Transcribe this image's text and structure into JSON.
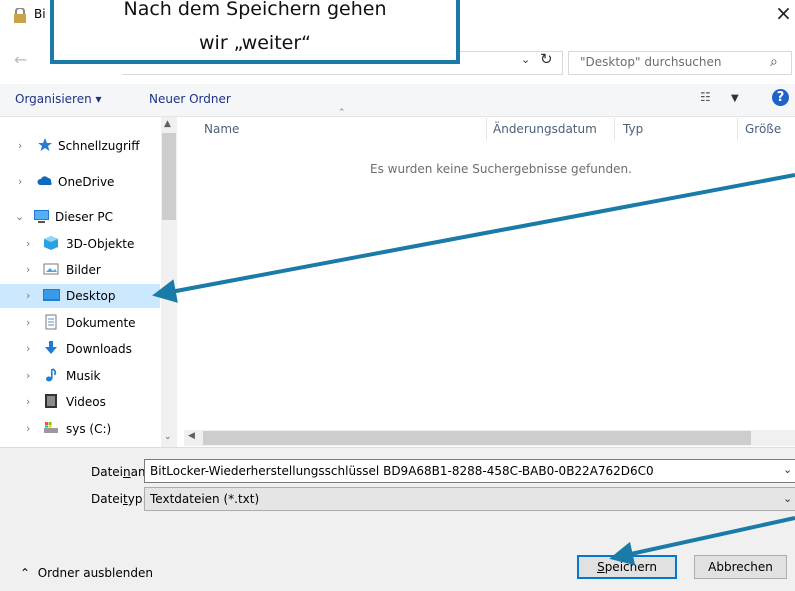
{
  "title": "Bitlocker-Wiederherstellungsschlüssel speichern unter",
  "title_visible": "Bi",
  "callout": {
    "line1": "Nach dem Speichern gehen",
    "line2": "wir „weiter“"
  },
  "address": {
    "refresh_icon": "refresh-icon",
    "dropdown_icon": "chevron-down-icon"
  },
  "search": {
    "placeholder": "\"Desktop\" durchsuchen"
  },
  "toolbar": {
    "organize_label": "Organisieren ▾",
    "new_folder_label": "Neuer Ordner",
    "help_label": "?"
  },
  "nav": {
    "items": [
      {
        "label": "Schnellzugriff",
        "icon": "star-icon"
      },
      {
        "label": "OneDrive",
        "icon": "cloud-icon"
      },
      {
        "label": "Dieser PC",
        "icon": "computer-icon"
      },
      {
        "label": "3D-Objekte",
        "icon": "cube-icon"
      },
      {
        "label": "Bilder",
        "icon": "pictures-icon"
      },
      {
        "label": "Desktop",
        "icon": "desktop-icon",
        "selected": true
      },
      {
        "label": "Dokumente",
        "icon": "document-icon"
      },
      {
        "label": "Downloads",
        "icon": "download-icon"
      },
      {
        "label": "Musik",
        "icon": "music-icon"
      },
      {
        "label": "Videos",
        "icon": "video-icon"
      },
      {
        "label": "sys (C:)",
        "icon": "drive-icon"
      }
    ]
  },
  "list": {
    "columns": [
      "Name",
      "Änderungsdatum",
      "Typ",
      "Größe"
    ],
    "empty_message": "Es wurden keine Suchergebnisse gefunden."
  },
  "filename": {
    "label_pre": "Datei",
    "label_u": "n",
    "label_post": "ame:",
    "value": "BitLocker-Wiederherstellungsschlüssel BD9A68B1-8288-458C-BAB0-0B22A762D6C0"
  },
  "filetype": {
    "label_pre": "Datei",
    "label_u": "t",
    "label_post": "yp:",
    "value": "Textdateien (*.txt)"
  },
  "footer": {
    "hide_folders": "Ordner ausblenden"
  },
  "buttons": {
    "save_u": "S",
    "save_rest": "peichern",
    "cancel": "Abbrechen"
  },
  "colors": {
    "accent": "#0078d7",
    "callout_border": "#1a7aa8",
    "selection": "#cce8ff"
  }
}
